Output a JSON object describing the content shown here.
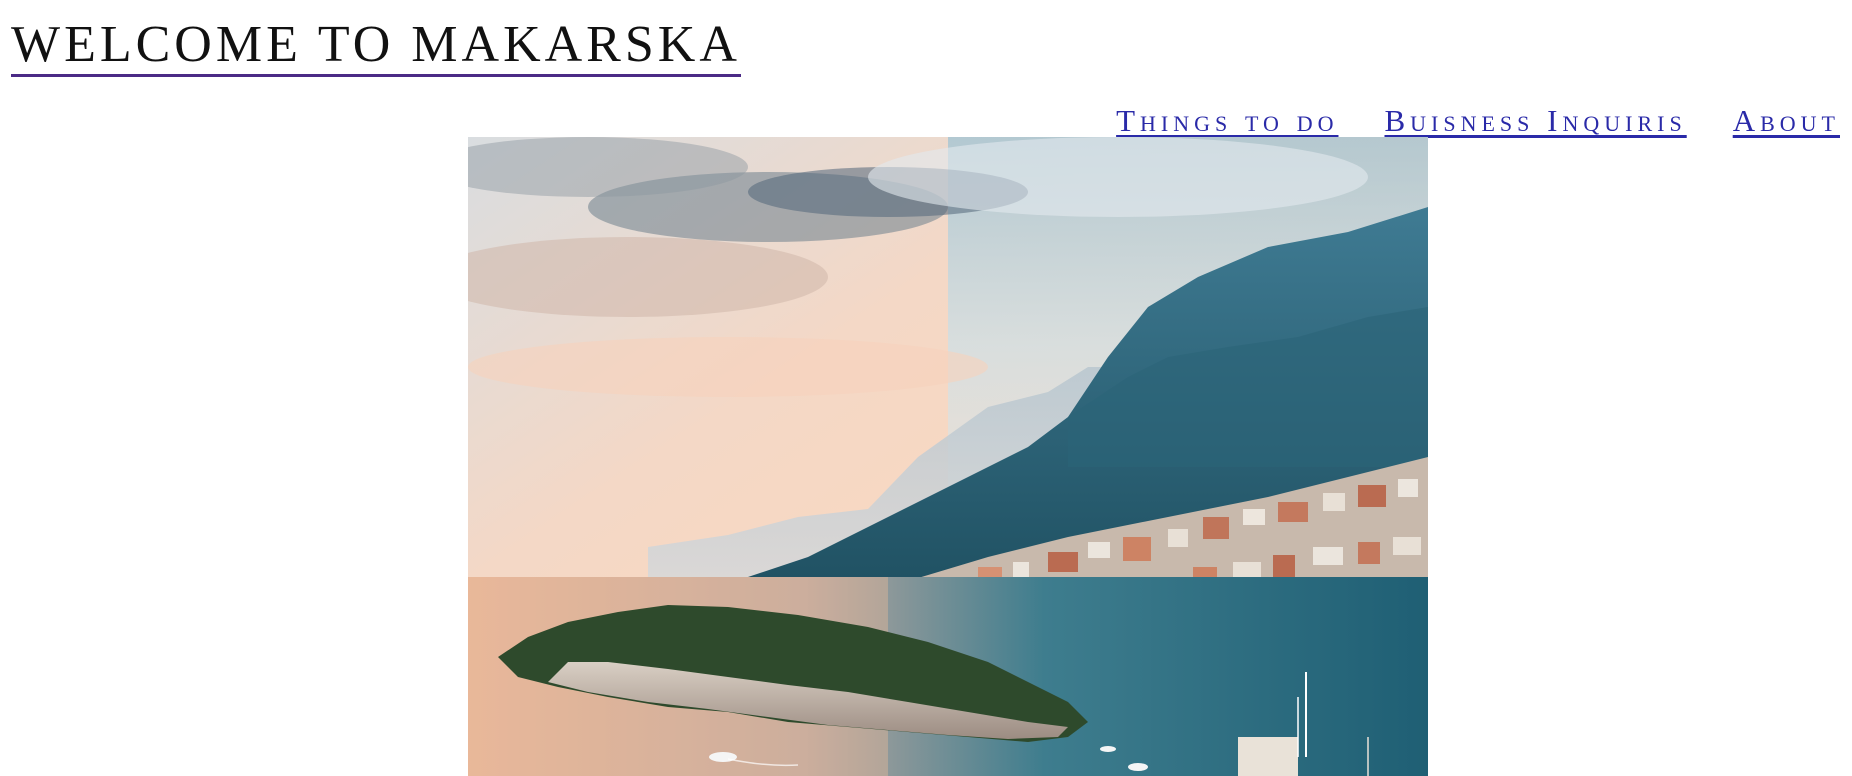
{
  "header": {
    "title": "WELCOME TO MAKARSKA"
  },
  "nav": {
    "items": [
      {
        "label": "Things to do"
      },
      {
        "label": "Buisness Inquiris"
      },
      {
        "label": "About"
      }
    ]
  },
  "colors": {
    "title_underline": "#4b2a86",
    "nav_link": "#2a2aa8",
    "title_text": "#111111"
  }
}
